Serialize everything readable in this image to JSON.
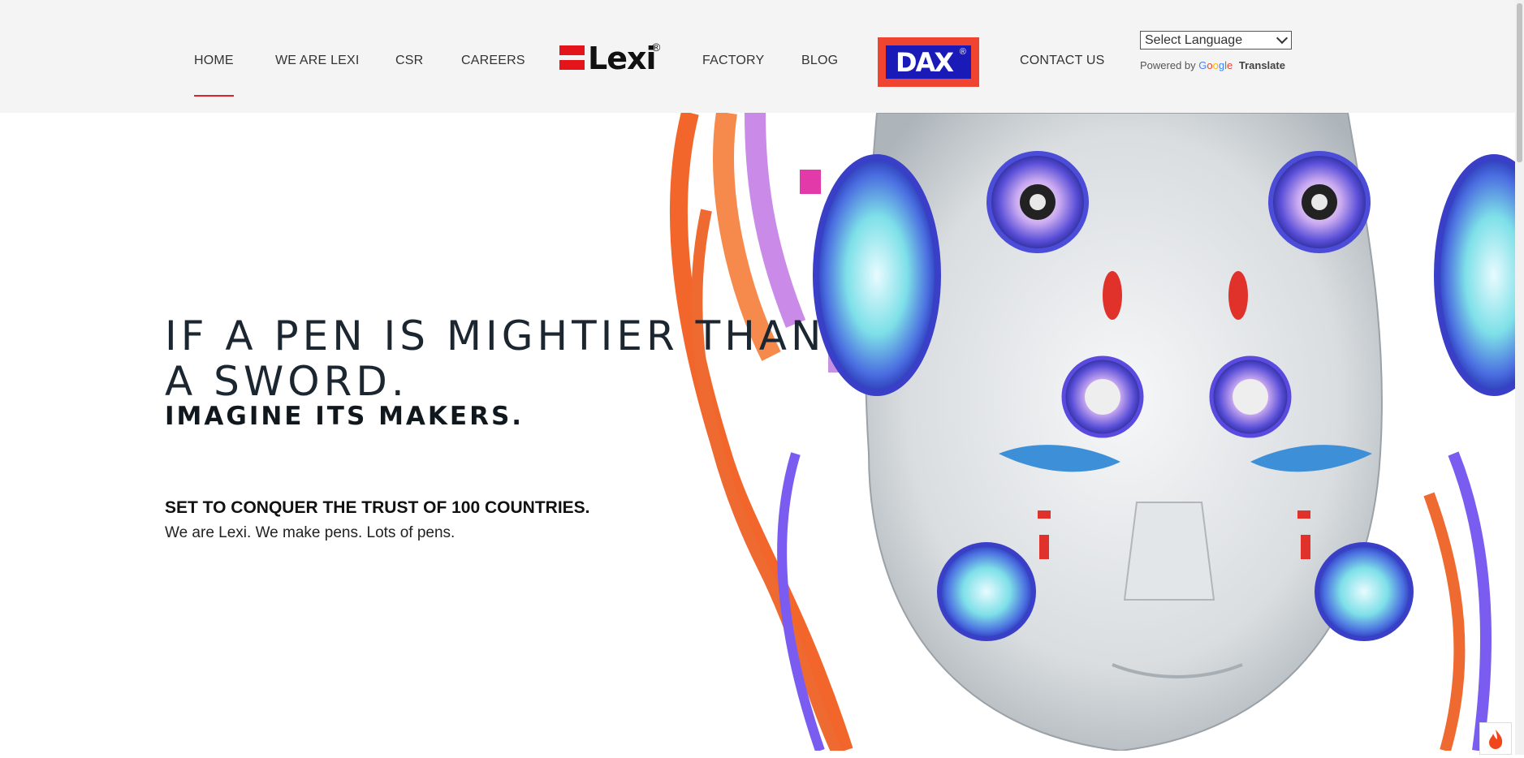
{
  "nav": {
    "items": [
      {
        "label": "HOME",
        "active": true
      },
      {
        "label": "WE ARE LEXI"
      },
      {
        "label": "CSR"
      },
      {
        "label": "CAREERS"
      },
      {
        "label": "FACTORY"
      },
      {
        "label": "BLOG"
      },
      {
        "label": "CONTACT US"
      }
    ],
    "active_color": "#e2222a"
  },
  "logos": {
    "lexi": {
      "text": "Lexi",
      "mark": "®",
      "brand_color": "#e3151a"
    },
    "dax": {
      "text": "DAX",
      "mark": "®",
      "frame_color": "#ee4430",
      "fill_color": "#1a1ab8"
    }
  },
  "translate": {
    "select_value": "Select Language",
    "powered_by": "Powered by",
    "google_letters": [
      "G",
      "o",
      "o",
      "g",
      "l",
      "e"
    ],
    "translate_label": "Translate"
  },
  "hero": {
    "headline_line1": "IF A PEN IS MIGHTIER THAN",
    "headline_line2": "A SWORD.",
    "subheadline": "IMAGINE ITS MAKERS.",
    "tagline": "SET TO CONQUER THE TRUST OF 100 COUNTRIES.",
    "intro": "We are Lexi. We make pens. Lots of pens."
  },
  "colors": {
    "header_bg": "#f4f4f4",
    "headline": "#1b2630"
  }
}
